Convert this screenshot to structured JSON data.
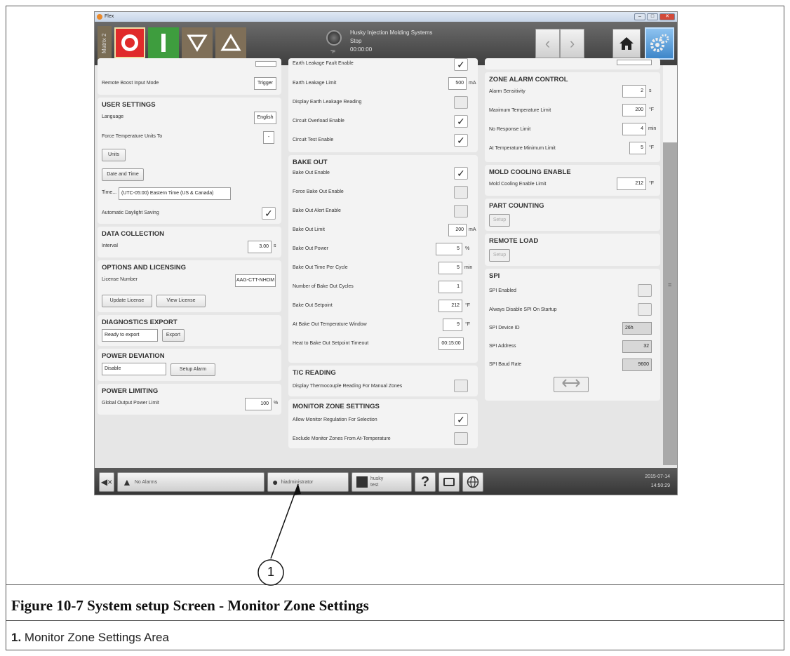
{
  "window": {
    "title": "Flex"
  },
  "toolbar": {
    "matrix_label": "Matrix 2",
    "status_lines": [
      "Husky Injection Molding Systems",
      "Stop",
      "00:00:00"
    ],
    "unit": "°F"
  },
  "col1": {
    "remote_boost_label": "Remote Boost Input Mode",
    "remote_boost_value": "Trigger",
    "user_settings": {
      "title": "USER SETTINGS",
      "language_label": "Language",
      "language_value": "English",
      "force_units_label": "Force Temperature Units To",
      "force_units_value": "-",
      "units_button": "Units",
      "date_time_button": "Date and Time",
      "time_label": "Time...",
      "time_value": "(UTC-05:00) Eastern Time (US & Canada)",
      "dst_label": "Automatic Daylight Saving",
      "dst_checked": "✓"
    },
    "data_collection": {
      "title": "DATA COLLECTION",
      "interval_label": "Interval",
      "interval_value": "3.00",
      "interval_unit": "s"
    },
    "options_licensing": {
      "title": "OPTIONS AND LICENSING",
      "license_label": "License Number",
      "license_value": "AAG-CTT-NHOM",
      "update_button": "Update License",
      "view_button": "View License"
    },
    "diagnostics": {
      "title": "DIAGNOSTICS EXPORT",
      "status_value": "Ready to export",
      "export_button": "Export"
    },
    "power_deviation": {
      "title": "POWER DEVIATION",
      "mode_value": "Disable",
      "setup_button": "Setup Alarm"
    },
    "power_limiting": {
      "title": "POWER LIMITING",
      "limit_label": "Global Output Power Limit",
      "limit_value": "100",
      "limit_unit": "%"
    }
  },
  "col2": {
    "earth": {
      "fault_enable_label": "Earth Leakage Fault Enable",
      "fault_enable": "✓",
      "limit_label": "Earth Leakage Limit",
      "limit_value": "500",
      "limit_unit": "mA",
      "display_label": "Display Earth Leakage Reading",
      "display": "",
      "overload_label": "Circuit Overload Enable",
      "overload": "✓",
      "test_label": "Circuit Test Enable",
      "test": "✓"
    },
    "bake_out": {
      "title": "BAKE OUT",
      "enable_label": "Bake Out Enable",
      "enable": "✓",
      "force_label": "Force Bake Out Enable",
      "force": "",
      "alert_label": "Bake Out Alert Enable",
      "alert": "",
      "limit_label": "Bake Out Limit",
      "limit_value": "200",
      "limit_unit": "mA",
      "power_label": "Bake Out Power",
      "power_value": "5",
      "power_unit": "%",
      "time_label": "Bake Out Time Per Cycle",
      "time_value": "5",
      "time_unit": "min",
      "cycles_label": "Number of Bake Out Cycles",
      "cycles_value": "1",
      "setpoint_label": "Bake Out Setpoint",
      "setpoint_value": "212",
      "setpoint_unit": "°F",
      "window_label": "At Bake Out Temperature Window",
      "window_value": "9",
      "window_unit": "°F",
      "timeout_label": "Heat to Bake Out Setpoint Timeout",
      "timeout_value": "00:15:00"
    },
    "tc_reading": {
      "title": "T/C READING",
      "display_label": "Display Thermocouple Reading For Manual Zones",
      "display": ""
    },
    "monitor_zone": {
      "title": "MONITOR ZONE SETTINGS",
      "allow_label": "Allow Monitor Regulation For Selection",
      "allow": "✓",
      "exclude_label": "Exclude Monitor Zones From At-Temperature",
      "exclude": ""
    }
  },
  "col3": {
    "zone_alarm": {
      "title": "ZONE ALARM CONTROL",
      "sensitivity_label": "Alarm Sensitivity",
      "sensitivity_value": "2",
      "sensitivity_unit": "s",
      "max_temp_label": "Maximum Temperature Limit",
      "max_temp_value": "200",
      "max_temp_unit": "°F",
      "no_response_label": "No Response Limit",
      "no_response_value": "4",
      "no_response_unit": "min",
      "at_temp_label": "At Temperature Minimum Limit",
      "at_temp_value": "5",
      "at_temp_unit": "°F"
    },
    "mold_cooling": {
      "title": "MOLD COOLING ENABLE",
      "limit_label": "Mold Cooling Enable Limit",
      "limit_value": "212",
      "limit_unit": "°F"
    },
    "part_counting": {
      "title": "PART COUNTING",
      "setup_button": "Setup"
    },
    "remote_load": {
      "title": "REMOTE LOAD",
      "setup_button": "Setup"
    },
    "spi": {
      "title": "SPI",
      "enabled_label": "SPI Enabled",
      "disable_label": "Always Disable SPI On Startup",
      "device_label": "SPI Device ID",
      "device_value": "26h",
      "address_label": "SPI Address",
      "address_value": "32",
      "baud_label": "SPI Baud Rate",
      "baud_value": "9600"
    }
  },
  "bottombar": {
    "alarms": "No Alarms",
    "user": "hiadministrator",
    "brand_line1": "husky",
    "brand_line2": "test",
    "date": "2015-07-14",
    "time": "14:50:29"
  },
  "callout": {
    "number": "1"
  },
  "caption": "Figure 10-7 System setup Screen - Monitor Zone Settings",
  "legend": {
    "number": "1.",
    "text": "Monitor Zone Settings Area"
  }
}
